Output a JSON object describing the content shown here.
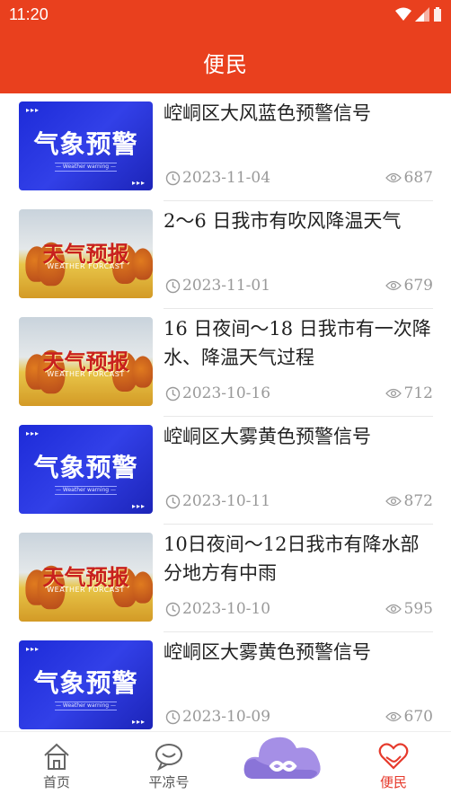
{
  "status_bar": {
    "time": "11:20"
  },
  "header": {
    "title": "便民"
  },
  "news": [
    {
      "image": "warning",
      "title": "崆峒区大风蓝色预警信号",
      "date": "2023-11-04",
      "views": "687"
    },
    {
      "image": "forecast",
      "title": "2～6 日我市有吹风降温天气",
      "date": "2023-11-01",
      "views": "679"
    },
    {
      "image": "forecast",
      "title": "16 日夜间～18 日我市有一次降水、降温天气过程",
      "date": "2023-10-16",
      "views": "712"
    },
    {
      "image": "warning",
      "title": "崆峒区大雾黄色预警信号",
      "date": "2023-10-11",
      "views": "872"
    },
    {
      "image": "forecast",
      "title": "10日夜间～12日我市有降水部分地方有中雨",
      "date": "2023-10-10",
      "views": "595"
    },
    {
      "image": "warning",
      "title": "崆峒区大雾黄色预警信号",
      "date": "2023-10-09",
      "views": "670"
    }
  ],
  "thumb_text": {
    "warning_big": "气象预警",
    "warning_sub": "— Weather warning —",
    "forecast_big": "天气预报",
    "forecast_sub": "WEATHER FORCAST",
    "dots": "▸▸▸"
  },
  "tabs": {
    "home": "首页",
    "pingliang": "平凉号",
    "bianmin": "便民"
  },
  "icons": {
    "clock": "clock-icon",
    "eye": "eye-icon",
    "home": "home-icon",
    "chat": "chat-bubble-icon",
    "cloud": "cloud-infinity-icon",
    "heart": "heart-hands-icon"
  },
  "colors": {
    "brand": "#e9401e",
    "active_tab": "#e63a2c",
    "meta_gray": "#999999"
  }
}
